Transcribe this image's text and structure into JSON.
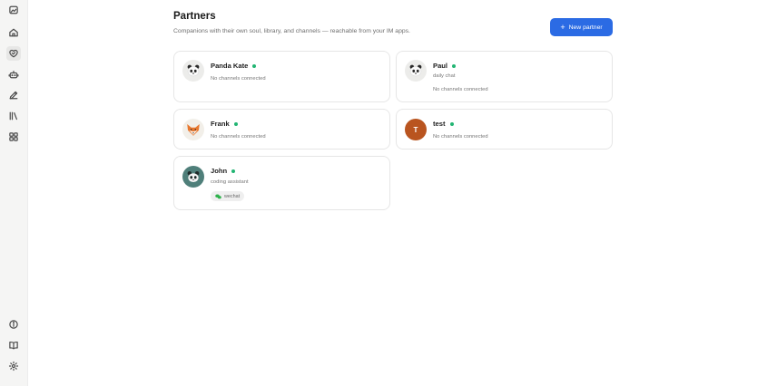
{
  "header": {
    "title": "Partners",
    "subtitle": "Companions with their own soul, library, and channels — reachable from your IM apps.",
    "new_partner_label": "New partner"
  },
  "sidebar": {
    "items": [
      {
        "icon": "logo-icon"
      },
      {
        "icon": "home-icon"
      },
      {
        "icon": "partners-icon",
        "active": true
      },
      {
        "icon": "robot-icon"
      },
      {
        "icon": "pencil-icon"
      },
      {
        "icon": "library-icon"
      },
      {
        "icon": "grid-icon"
      }
    ],
    "bottom_items": [
      {
        "icon": "info-icon"
      },
      {
        "icon": "book-icon"
      },
      {
        "icon": "settings-icon"
      }
    ]
  },
  "partners": [
    {
      "name": "Panda Kate",
      "status": "online",
      "description": "",
      "channels_text": "No channels connected",
      "avatar": "panda"
    },
    {
      "name": "Paul",
      "status": "online",
      "description": "daily chat",
      "channels_text": "No channels connected",
      "avatar": "panda"
    },
    {
      "name": "Frank",
      "status": "online",
      "description": "",
      "channels_text": "No channels connected",
      "avatar": "fox"
    },
    {
      "name": "test",
      "status": "online",
      "description": "",
      "channels_text": "No channels connected",
      "avatar": "letter",
      "avatar_letter": "T"
    },
    {
      "name": "John",
      "status": "online",
      "description": "coding assistant",
      "channel_chip": "wechat",
      "avatar": "panda-teal"
    }
  ],
  "colors": {
    "accent": "#2b6be4",
    "online": "#22b573",
    "test_avatar": "#b9541f",
    "john_avatar": "#4f7f7a"
  }
}
